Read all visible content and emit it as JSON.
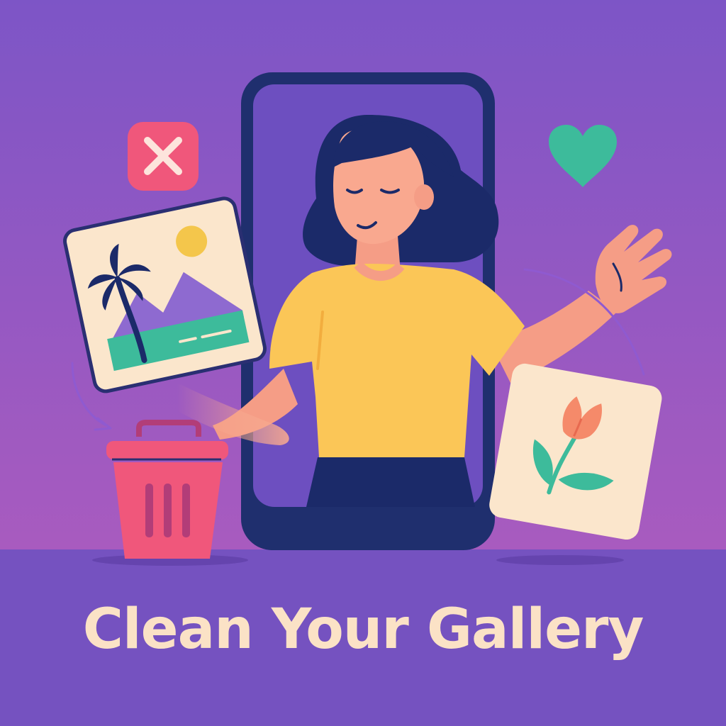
{
  "headline": "Clean Your Gallery",
  "colors": {
    "background_top": "#7d55c6",
    "background_bottom": "#a85bbf",
    "floor": "#7552c0",
    "phone_frame": "#1f2f6e",
    "phone_screen": "#6d4fc0",
    "reject_badge": "#f0577b",
    "like_heart": "#3dbb9b",
    "trash_bin": "#f0577b",
    "shirt": "#fbc657",
    "hair": "#1b2a69",
    "skin": "#f59d86",
    "card_paper": "#fbe6cc",
    "headline_text": "#fbe2c6"
  },
  "icons": {
    "reject": "close-x-icon",
    "like": "heart-icon",
    "delete": "trash-bin-icon",
    "beach_photo": "landscape-photo-icon",
    "flower_photo": "tulip-photo-icon"
  }
}
